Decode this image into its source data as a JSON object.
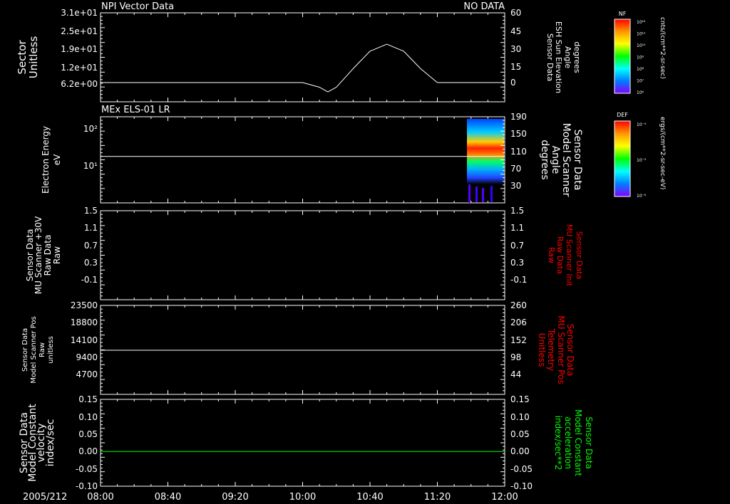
{
  "date_label": "2005/212",
  "time_ticks": [
    "08:00",
    "08:40",
    "09:20",
    "10:00",
    "10:40",
    "11:20",
    "12:00"
  ],
  "colors": {
    "axes": "#ffffff",
    "red": "#ff0000",
    "green": "#00ff00",
    "background": "#000000"
  },
  "chart_data": [
    {
      "type": "line",
      "panel_title": "NPI Vector Data",
      "status": "NO DATA",
      "ylabel_left": [
        "Sector",
        "Unitless"
      ],
      "yticks_left": [
        "3.1e+01",
        "2.5e+01",
        "1.9e+01",
        "1.2e+01",
        "6.2e+00"
      ],
      "ylabel_right": [
        "Sensor Data",
        "ESH Sun Elevation",
        "Angle",
        "degrees"
      ],
      "yticks_right": [
        "60",
        "45",
        "30",
        "15",
        "0"
      ],
      "ylim_right": [
        -15,
        60
      ],
      "series": [
        {
          "x": [
            "08:00",
            "10:00",
            "10:10",
            "10:15",
            "10:20",
            "10:30",
            "10:40",
            "10:50",
            "11:00",
            "11:10",
            "11:20",
            "12:00"
          ],
          "y": [
            0,
            0,
            -4,
            -8,
            -4,
            12,
            27,
            33,
            27,
            12,
            0,
            0
          ]
        }
      ]
    },
    {
      "type": "heatmap",
      "panel_title": "MEx ELS-01 LR",
      "ylabel_left": [
        "Electron Energy",
        "eV"
      ],
      "yticks_left": [
        "10²",
        "10¹"
      ],
      "yscale": "log",
      "ylabel_right": [
        "Sensor Data",
        "Model Scanner",
        "Angle",
        "degrees"
      ],
      "yticks_right": [
        "190",
        "150",
        "110",
        "70",
        "30"
      ],
      "line_value_right": 98,
      "data_extent": {
        "x_start": "11:35",
        "x_end": "12:00"
      }
    },
    {
      "type": "line",
      "ylabel_left": [
        "Sensor Data",
        "MU Scanner +30V",
        "Raw Data",
        "Raw"
      ],
      "yticks_left": [
        "1.5",
        "1.1",
        "0.7",
        "0.3",
        "-0.1"
      ],
      "ylabel_right": [
        "Sensor Data",
        "MU Scanner Init",
        "Raw Data",
        "Raw"
      ],
      "yticks_right": [
        "1.5",
        "1.1",
        "0.7",
        "0.3",
        "-0.1"
      ],
      "right_label_color": "red",
      "series": []
    },
    {
      "type": "line",
      "ylabel_left": [
        "Sensor Data",
        "Model Scanner Pos",
        "Raw",
        "unitless"
      ],
      "yticks_left": [
        "23500",
        "18800",
        "14100",
        "9400",
        "4700"
      ],
      "ylabel_right": [
        "Sensor Data",
        "MU Scanner Pos",
        "Telemetry",
        "Unitless"
      ],
      "yticks_right": [
        "260",
        "206",
        "152",
        "98",
        "44"
      ],
      "right_label_color": "red",
      "series": [
        {
          "x": [
            "08:00",
            "12:00"
          ],
          "y": [
            11300,
            11300
          ]
        }
      ]
    },
    {
      "type": "line",
      "ylabel_left": [
        "Sensor Data",
        "Model Constant",
        "velocity",
        "index/sec"
      ],
      "yticks_left": [
        "0.15",
        "0.10",
        "0.05",
        "0.00",
        "-0.05",
        "-0.10"
      ],
      "ylabel_right": [
        "Sensor Data",
        "Model Constant",
        "acceleration",
        "index/sec**2"
      ],
      "yticks_right": [
        "0.15",
        "0.10",
        "0.05",
        "0.00",
        "-0.05",
        "-0.10"
      ],
      "right_label_color": "green",
      "series": [
        {
          "x": [
            "08:00",
            "12:00"
          ],
          "y": [
            0,
            0
          ],
          "color": "green"
        }
      ]
    }
  ],
  "colorbars": [
    {
      "label": "NF",
      "unit": "cnts/(cm**2-sr-sec)",
      "ticks": [
        "10¹²",
        "10¹¹",
        "10¹⁰",
        "10⁹",
        "10⁸",
        "10⁷",
        "10⁶"
      ]
    },
    {
      "label": "DEF",
      "unit": "ergs/(cm**2-sr-sec-eV)",
      "ticks": [
        "10⁻⁴",
        "10⁻⁵",
        "10⁻⁶"
      ]
    }
  ]
}
